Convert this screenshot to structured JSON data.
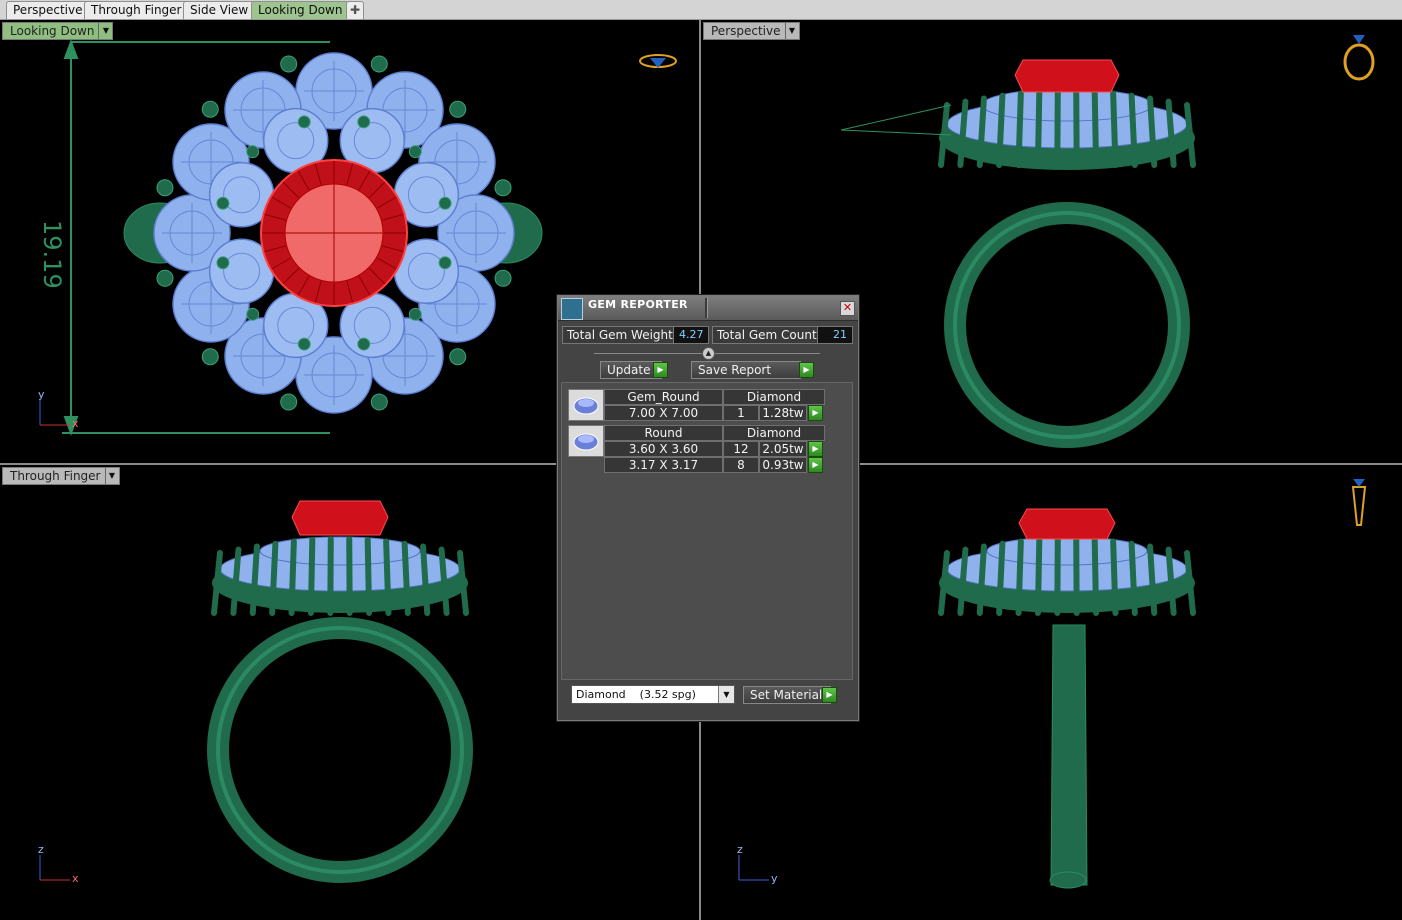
{
  "tabs": [
    {
      "label": "Perspective",
      "active": false
    },
    {
      "label": "Through Finger",
      "active": false
    },
    {
      "label": "Side View",
      "active": false
    },
    {
      "label": "Looking Down",
      "active": true
    }
  ],
  "tab_add_icon": "plus-icon",
  "viewports": {
    "top_left": {
      "label": "Looking Down",
      "dimension": "19.19",
      "axis_x": "x",
      "axis_y": "y"
    },
    "top_right": {
      "label": "Perspective"
    },
    "bottom_left": {
      "label": "Through Finger",
      "axis_x": "x",
      "axis_y": "z"
    },
    "bottom_right": {
      "label": "",
      "axis_x": "y",
      "axis_y": "z"
    }
  },
  "gem_reporter": {
    "title": "GEM REPORTER",
    "total_weight_label": "Total Gem Weight",
    "total_weight_value": "4.27",
    "total_count_label": "Total Gem Count",
    "total_count_value": "21",
    "update_label": "Update",
    "save_label": "Save Report",
    "groups": [
      {
        "shape": "Gem_Round",
        "material": "Diamond",
        "rows": [
          {
            "size": "7.00 X 7.00",
            "count": "1",
            "weight": "1.28tw"
          }
        ]
      },
      {
        "shape": "Round",
        "material": "Diamond",
        "rows": [
          {
            "size": "3.60 X 3.60",
            "count": "12",
            "weight": "2.05tw"
          },
          {
            "size": "3.17 X 3.17",
            "count": "8",
            "weight": "0.93tw"
          }
        ]
      }
    ],
    "material_select": "Diamond    (3.52 spg)",
    "set_material_label": "Set Material"
  },
  "colors": {
    "metal": "#1f6b4c",
    "gem_blue": "#8fb1ee",
    "ruby": "#e0191f",
    "tab_active": "#9ec48f",
    "label_active": "#8fbf80",
    "dimension": "#2e9160"
  }
}
